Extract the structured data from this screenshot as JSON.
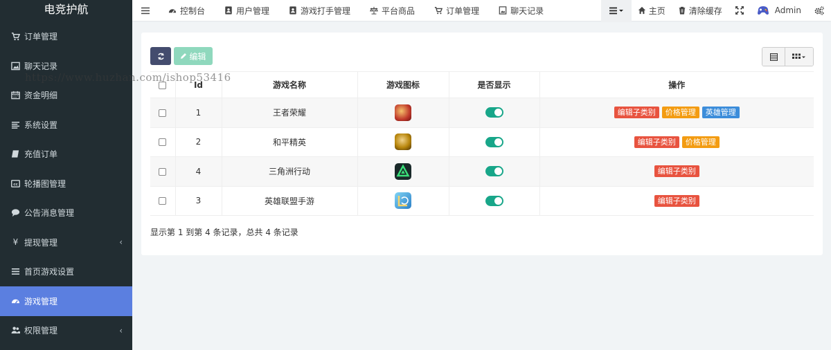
{
  "sidebar": {
    "brand": "电竞护航",
    "items": [
      {
        "label": "订单管理",
        "icon": "cart-icon"
      },
      {
        "label": "聊天记录",
        "icon": "image-icon"
      },
      {
        "label": "资金明细",
        "icon": "calendar-icon"
      },
      {
        "label": "系统设置",
        "icon": "list-icon"
      },
      {
        "label": "充值订单",
        "icon": "book-icon"
      },
      {
        "label": "轮播图管理",
        "icon": "cc-icon"
      },
      {
        "label": "公告消息管理",
        "icon": "comment-icon"
      },
      {
        "label": "提现管理",
        "icon": "yen-icon",
        "chevron": "‹"
      },
      {
        "label": "首页游戏设置",
        "icon": "bars-icon"
      },
      {
        "label": "游戏管理",
        "icon": "dashboard-icon",
        "active": true
      },
      {
        "label": "权限管理",
        "icon": "users-icon",
        "chevron": "‹"
      }
    ]
  },
  "topbar": {
    "tabs": [
      {
        "label": "控制台",
        "icon": "dashboard-icon"
      },
      {
        "label": "用户管理",
        "icon": "user-card-icon"
      },
      {
        "label": "游戏打手管理",
        "icon": "user-card-icon"
      },
      {
        "label": "平台商品",
        "icon": "balance-icon"
      },
      {
        "label": "订单管理",
        "icon": "cart-icon"
      },
      {
        "label": "聊天记录",
        "icon": "image-icon"
      }
    ],
    "home_label": "主页",
    "clear_cache_label": "清除缓存",
    "user_name": "Admin"
  },
  "table": {
    "columns": [
      "Id",
      "游戏名称",
      "游戏图标",
      "是否显示",
      "操作"
    ],
    "rows": [
      {
        "id": "1",
        "name": "王者荣耀",
        "icon_color": "#c0392b",
        "visible": true,
        "ops": [
          "编辑子类别",
          "价格管理",
          "英雄管理"
        ]
      },
      {
        "id": "2",
        "name": "和平精英",
        "icon_color": "#b8860b",
        "visible": true,
        "ops": [
          "编辑子类别",
          "价格管理"
        ]
      },
      {
        "id": "4",
        "name": "三角洲行动",
        "icon_color": "#1a2a2a",
        "visible": true,
        "ops": [
          "编辑子类别"
        ]
      },
      {
        "id": "3",
        "name": "英雄联盟手游",
        "icon_color": "#3aa0d8",
        "visible": true,
        "ops": [
          "编辑子类别"
        ]
      }
    ]
  },
  "toolbar": {
    "edit_label": "编辑"
  },
  "pager_info": "显示第 1 到第 4 条记录，总共 4 条记录",
  "watermark": "https://www.huzhan.com/ishop53416",
  "colors": {
    "sidebar_bg": "#222d32",
    "active": "#5b7fe0",
    "toggle_on": "#18a689",
    "op_red": "#e8533f",
    "op_orange": "#f39c12",
    "op_blue": "#3c8dda"
  }
}
